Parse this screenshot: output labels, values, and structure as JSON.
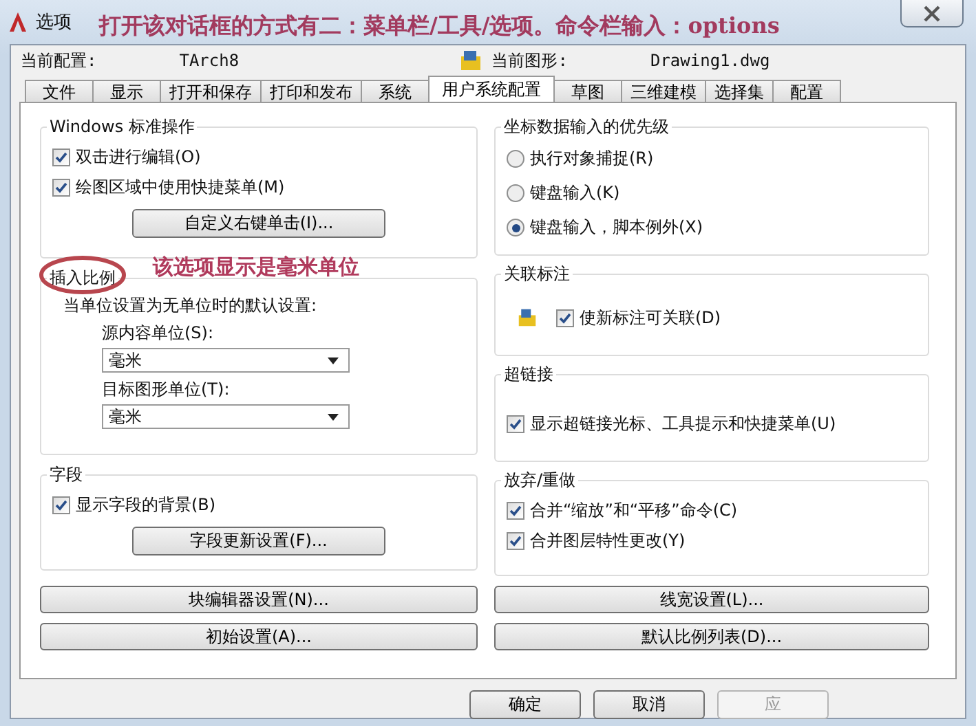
{
  "window": {
    "title": "选项",
    "annotation": "打开该对话框的方式有二：菜单栏/工具/选项。命令栏输入：options"
  },
  "profile": {
    "label": "当前配置:",
    "value": "TArch8"
  },
  "drawing": {
    "label": "当前图形:",
    "value": "Drawing1.dwg"
  },
  "tabs": [
    {
      "label": "文件",
      "selected": false
    },
    {
      "label": "显示",
      "selected": false
    },
    {
      "label": "打开和保存",
      "selected": false
    },
    {
      "label": "打印和发布",
      "selected": false
    },
    {
      "label": "系统",
      "selected": false
    },
    {
      "label": "用户系统配置",
      "selected": true
    },
    {
      "label": "草图",
      "selected": false
    },
    {
      "label": "三维建模",
      "selected": false
    },
    {
      "label": "选择集",
      "selected": false
    },
    {
      "label": "配置",
      "selected": false
    }
  ],
  "left_groups": [
    {
      "title": "Windows 标准操作",
      "items": [
        {
          "kind": "checkbox",
          "label": "双击进行编辑(O)",
          "checked": true
        },
        {
          "kind": "checkbox",
          "label": "绘图区域中使用快捷菜单(M)",
          "checked": true
        },
        {
          "kind": "button",
          "label": "自定义右键单击(I)..."
        }
      ]
    },
    {
      "title": "插入比例",
      "items": [
        {
          "kind": "text",
          "label": "当单位设置为无单位时的默认设置:"
        },
        {
          "kind": "select",
          "label": "源内容单位(S):",
          "value": "毫米"
        },
        {
          "kind": "select",
          "label": "目标图形单位(T):",
          "value": "毫米"
        }
      ]
    },
    {
      "title": "字段",
      "items": [
        {
          "kind": "checkbox",
          "label": "显示字段的背景(B)",
          "checked": true
        },
        {
          "kind": "button",
          "label": "字段更新设置(F)..."
        }
      ]
    }
  ],
  "right_groups": [
    {
      "title": "坐标数据输入的优先级",
      "items": [
        {
          "kind": "radio",
          "label": "执行对象捕捉(R)",
          "selected": false
        },
        {
          "kind": "radio",
          "label": "键盘输入(K)",
          "selected": false
        },
        {
          "kind": "radio",
          "label": "键盘输入，脚本例外(X)",
          "selected": true
        }
      ]
    },
    {
      "title": "关联标注",
      "items": [
        {
          "kind": "checkbox",
          "label": "使新标注可关联(D)",
          "checked": true,
          "icon": true
        }
      ]
    },
    {
      "title": "超链接",
      "items": [
        {
          "kind": "checkbox",
          "label": "显示超链接光标、工具提示和快捷菜单(U)",
          "checked": true
        }
      ]
    },
    {
      "title": "放弃/重做",
      "items": [
        {
          "kind": "checkbox",
          "label": "合并“缩放”和“平移”命令(C)",
          "checked": true
        },
        {
          "kind": "checkbox",
          "label": "合并图层特性更改(Y)",
          "checked": true
        }
      ]
    }
  ],
  "wide_buttons": [
    "块编辑器设置(N)...",
    "线宽设置(L)...",
    "初始设置(A)...",
    "默认比例列表(D)..."
  ],
  "note": "该选项显示是毫米单位",
  "dialog_buttons": [
    {
      "label": "确定",
      "disabled": false
    },
    {
      "label": "取消",
      "disabled": false
    },
    {
      "label": "应",
      "disabled": true
    }
  ]
}
